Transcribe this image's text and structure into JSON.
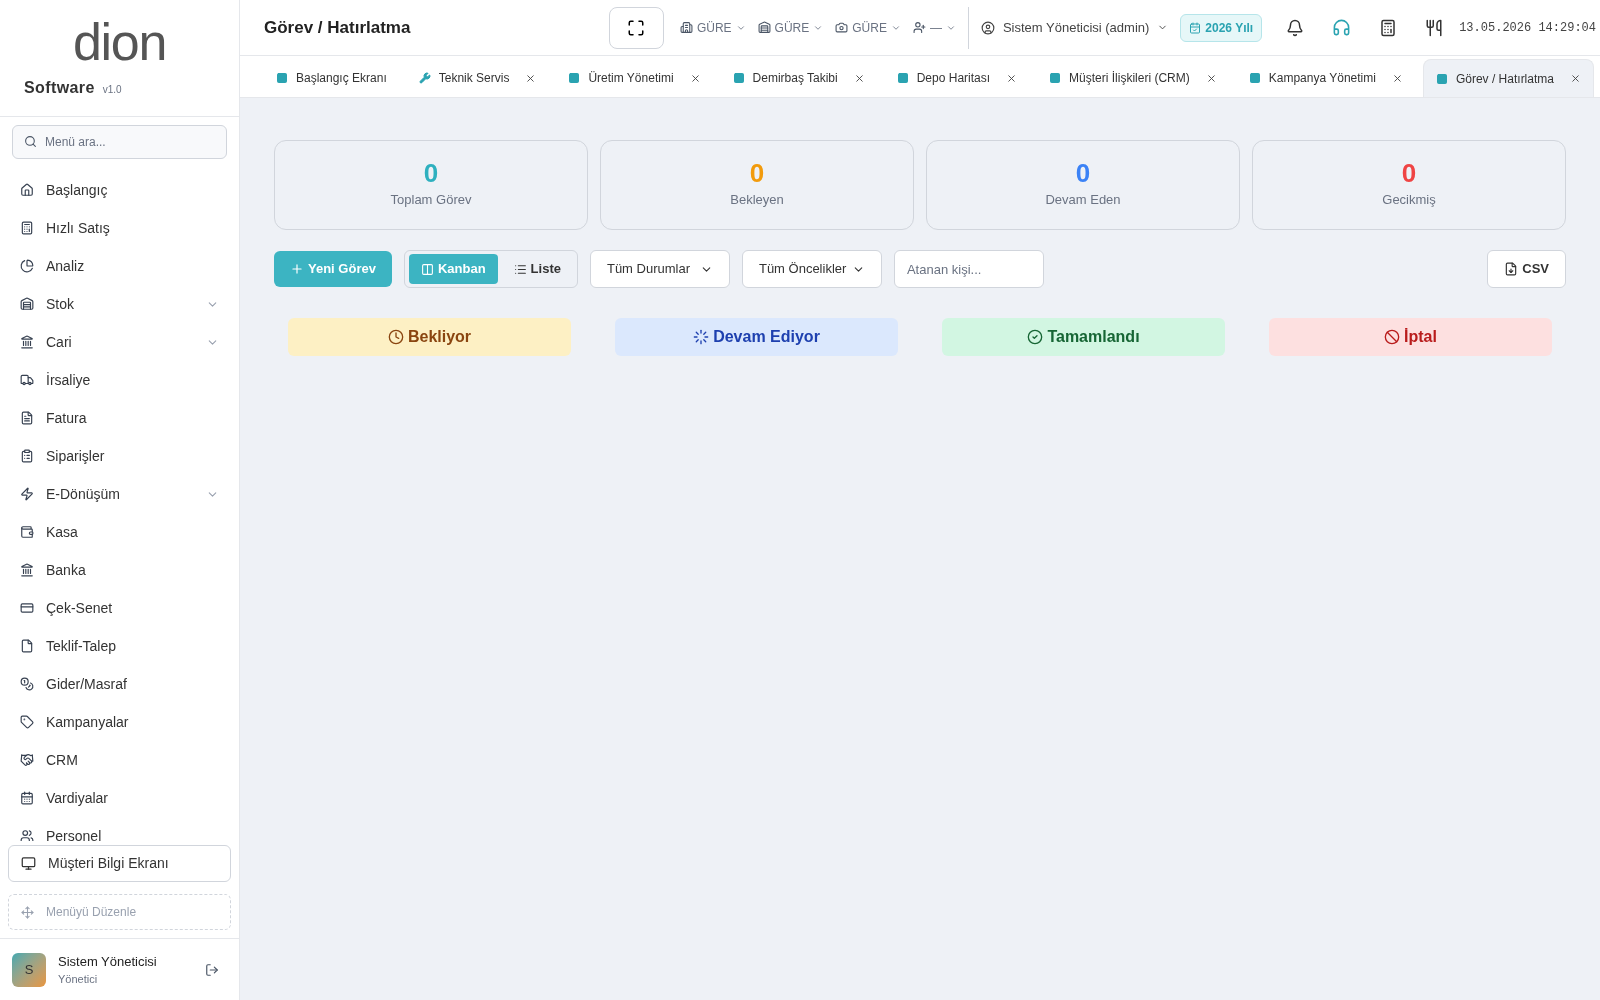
{
  "sidebar": {
    "logo": "dion",
    "brand": "Software",
    "version": "v1.0",
    "search": {
      "placeholder": "Menü ara..."
    },
    "items": [
      {
        "label": "Başlangıç",
        "has_submenu": false
      },
      {
        "label": "Hızlı Satış",
        "has_submenu": false
      },
      {
        "label": "Analiz",
        "has_submenu": false
      },
      {
        "label": "Stok",
        "has_submenu": true
      },
      {
        "label": "Cari",
        "has_submenu": true
      },
      {
        "label": "İrsaliye",
        "has_submenu": false
      },
      {
        "label": "Fatura",
        "has_submenu": false
      },
      {
        "label": "Siparişler",
        "has_submenu": false
      },
      {
        "label": "E-Dönüşüm",
        "has_submenu": true
      },
      {
        "label": "Kasa",
        "has_submenu": false
      },
      {
        "label": "Banka",
        "has_submenu": false
      },
      {
        "label": "Çek-Senet",
        "has_submenu": false
      },
      {
        "label": "Teklif-Talep",
        "has_submenu": false
      },
      {
        "label": "Gider/Masraf",
        "has_submenu": false
      },
      {
        "label": "Kampanyalar",
        "has_submenu": false
      },
      {
        "label": "CRM",
        "has_submenu": false
      },
      {
        "label": "Vardiyalar",
        "has_submenu": false
      },
      {
        "label": "Personel",
        "has_submenu": false
      }
    ],
    "customer_screen": "Müşteri Bilgi Ekranı",
    "edit_menu": "Menüyü Düzenle",
    "user": {
      "initial": "S",
      "name": "Sistem Yöneticisi",
      "role": "Yönetici"
    }
  },
  "header": {
    "title": "Görev / Hatırlatma",
    "selectors": [
      {
        "label": "GÜRE"
      },
      {
        "label": "GÜRE"
      },
      {
        "label": "GÜRE"
      },
      {
        "label": "—"
      }
    ],
    "user": "Sistem Yöneticisi (admin)",
    "year": "2026 Yılı",
    "datetime": "13.05.2026 14:29:04"
  },
  "tabs": [
    {
      "label": "Başlangıç Ekranı",
      "closable": false,
      "selected": false
    },
    {
      "label": "Teknik Servis",
      "closable": true,
      "selected": false
    },
    {
      "label": "Üretim Yönetimi",
      "closable": true,
      "selected": false
    },
    {
      "label": "Demirbaş Takibi",
      "closable": true,
      "selected": false
    },
    {
      "label": "Depo Haritası",
      "closable": true,
      "selected": false
    },
    {
      "label": "Müşteri İlişkileri (CRM)",
      "closable": true,
      "selected": false
    },
    {
      "label": "Kampanya Yönetimi",
      "closable": true,
      "selected": false
    },
    {
      "label": "Görev / Hatırlatma",
      "closable": true,
      "selected": true
    }
  ],
  "stats": [
    {
      "value": "0",
      "label": "Toplam Görev",
      "color": "#2eb0bf"
    },
    {
      "value": "0",
      "label": "Bekleyen",
      "color": "#f29b0c"
    },
    {
      "value": "0",
      "label": "Devam Eden",
      "color": "#3b82f6"
    },
    {
      "value": "0",
      "label": "Gecikmiş",
      "color": "#ef4444"
    }
  ],
  "toolbar": {
    "new_button": "Yeni Görev",
    "views": [
      {
        "label": "Kanban",
        "selected": true
      },
      {
        "label": "Liste",
        "selected": false
      }
    ],
    "status_filter": "Tüm Durumlar",
    "priority_filter": "Tüm Öncelikler",
    "assignee": {
      "placeholder": "Atanan kişi..."
    },
    "export": "CSV"
  },
  "columns": [
    {
      "kind": "pending",
      "label": "Bekliyor",
      "color": "#fdf0c4"
    },
    {
      "kind": "progress",
      "label": "Devam Ediyor",
      "color": "#dbe8fd"
    },
    {
      "kind": "done",
      "label": "Tamamlandı",
      "color": "#d2f6e2"
    },
    {
      "kind": "cancelled",
      "label": "İptal",
      "color": "#fde0e0"
    }
  ]
}
